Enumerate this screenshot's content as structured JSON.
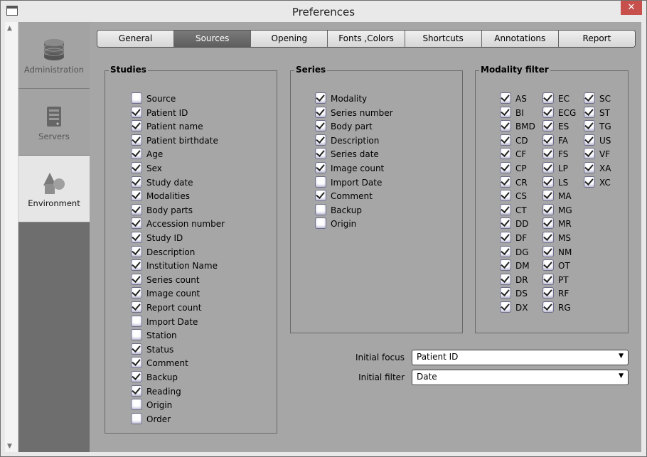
{
  "window": {
    "title": "Preferences",
    "close_glyph": "✕"
  },
  "sidebar": {
    "items": [
      {
        "label": "Administration",
        "icon": "database-icon",
        "active": false
      },
      {
        "label": "Servers",
        "icon": "server-icon",
        "active": false
      },
      {
        "label": "Environment",
        "icon": "shapes-icon",
        "active": true
      }
    ]
  },
  "tabs": [
    {
      "label": "General",
      "active": false
    },
    {
      "label": "Sources",
      "active": true
    },
    {
      "label": "Opening",
      "active": false
    },
    {
      "label": "Fonts ,Colors",
      "active": false
    },
    {
      "label": "Shortcuts",
      "active": false
    },
    {
      "label": "Annotations",
      "active": false
    },
    {
      "label": "Report",
      "active": false
    }
  ],
  "studies": {
    "title": "Studies",
    "items": [
      {
        "label": "Source",
        "checked": false
      },
      {
        "label": "Patient ID",
        "checked": true
      },
      {
        "label": "Patient name",
        "checked": true
      },
      {
        "label": "Patient birthdate",
        "checked": true
      },
      {
        "label": "Age",
        "checked": true
      },
      {
        "label": "Sex",
        "checked": true
      },
      {
        "label": "Study date",
        "checked": true
      },
      {
        "label": "Modalities",
        "checked": true
      },
      {
        "label": "Body parts",
        "checked": true
      },
      {
        "label": "Accession number",
        "checked": true
      },
      {
        "label": "Study ID",
        "checked": true
      },
      {
        "label": "Description",
        "checked": true
      },
      {
        "label": "Institution Name",
        "checked": true
      },
      {
        "label": "Series count",
        "checked": true
      },
      {
        "label": "Image count",
        "checked": true
      },
      {
        "label": "Report count",
        "checked": true
      },
      {
        "label": "Import Date",
        "checked": false
      },
      {
        "label": "Station",
        "checked": false
      },
      {
        "label": "Status",
        "checked": true
      },
      {
        "label": "Comment",
        "checked": true
      },
      {
        "label": "Backup",
        "checked": true
      },
      {
        "label": "Reading",
        "checked": true
      },
      {
        "label": "Origin",
        "checked": false
      },
      {
        "label": "Order",
        "checked": false
      }
    ]
  },
  "series": {
    "title": "Series",
    "items": [
      {
        "label": "Modality",
        "checked": true
      },
      {
        "label": "Series number",
        "checked": true
      },
      {
        "label": "Body part",
        "checked": true
      },
      {
        "label": "Description",
        "checked": true
      },
      {
        "label": "Series date",
        "checked": true
      },
      {
        "label": "Image count",
        "checked": true
      },
      {
        "label": "Import Date",
        "checked": false
      },
      {
        "label": "Comment",
        "checked": true
      },
      {
        "label": "Backup",
        "checked": false
      },
      {
        "label": "Origin",
        "checked": false
      }
    ]
  },
  "modality": {
    "title": "Modality filter",
    "columns": [
      [
        "AS",
        "BI",
        "BMD",
        "CD",
        "CF",
        "CP",
        "CR",
        "CS",
        "CT",
        "DD",
        "DF",
        "DG",
        "DM",
        "DR",
        "DS",
        "DX"
      ],
      [
        "EC",
        "ECG",
        "ES",
        "FA",
        "FS",
        "LP",
        "LS",
        "MA",
        "MG",
        "MR",
        "MS",
        "NM",
        "OT",
        "PT",
        "RF",
        "RG"
      ],
      [
        "SC",
        "ST",
        "TG",
        "US",
        "VF",
        "XA",
        "XC"
      ]
    ]
  },
  "initial_focus": {
    "label": "Initial focus",
    "value": "Patient ID"
  },
  "initial_filter": {
    "label": "Initial filter",
    "value": "Date"
  }
}
